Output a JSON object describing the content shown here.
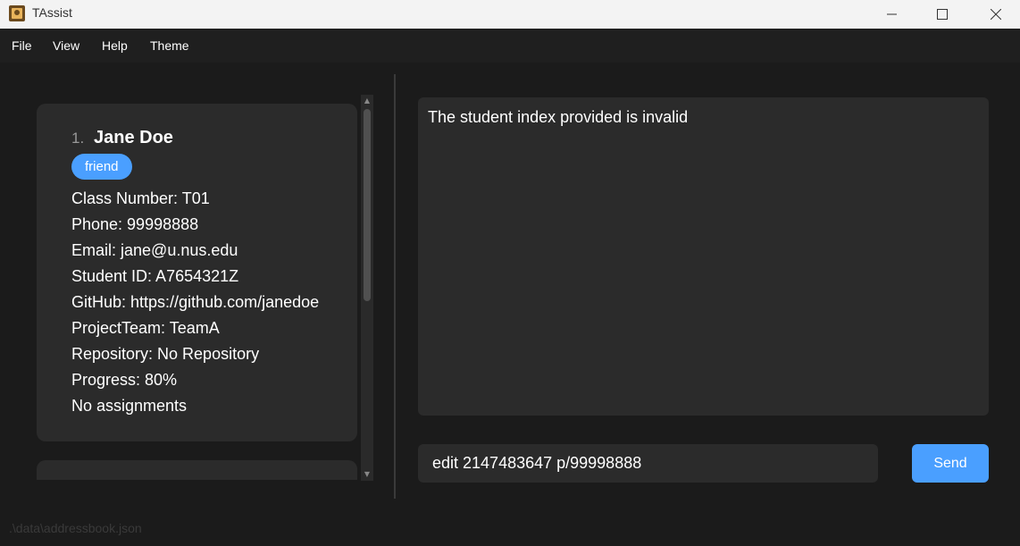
{
  "window": {
    "title": "TAssist",
    "icon": "tassist-app-icon"
  },
  "menu": {
    "items": [
      "File",
      "View",
      "Help",
      "Theme"
    ]
  },
  "student_list": {
    "cards": [
      {
        "index": "1.",
        "name": "Jane Doe",
        "tags": [
          "friend"
        ],
        "fields": [
          "Class Number: T01",
          "Phone: 99998888",
          "Email: jane@u.nus.edu",
          "Student ID: A7654321Z",
          "GitHub: https://github.com/janedoe",
          "ProjectTeam: TeamA",
          "Repository: No Repository",
          "Progress: 80%",
          "No assignments"
        ]
      }
    ]
  },
  "result_display": {
    "text": "The student index provided is invalid"
  },
  "command_box": {
    "value": "edit 2147483647 p/99998888",
    "send_label": "Send"
  },
  "status_bar": {
    "path": ".\\data\\addressbook.json"
  },
  "colors": {
    "accent": "#4a9fff",
    "card": "#2b2b2b",
    "background": "#1b1b1b"
  }
}
